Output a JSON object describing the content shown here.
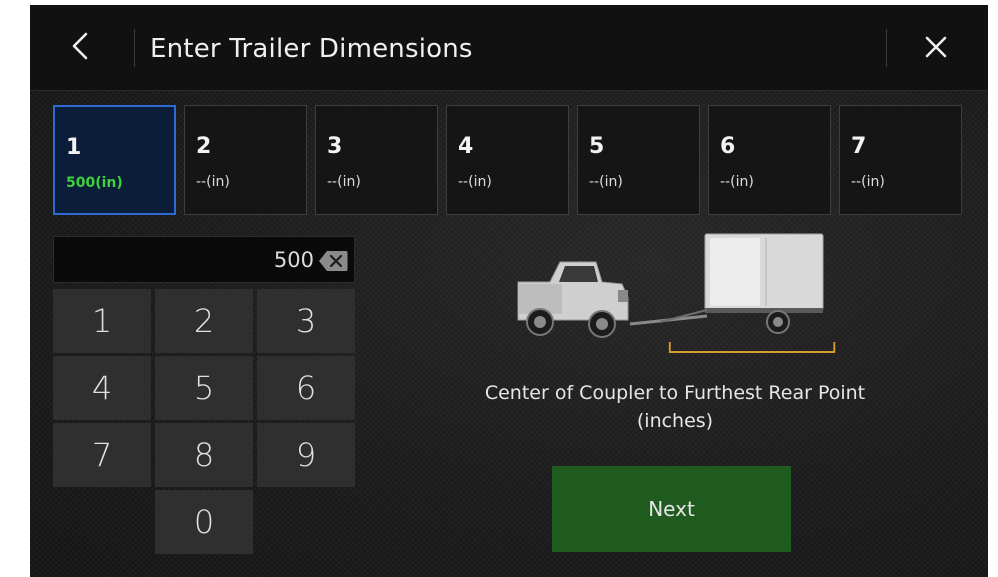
{
  "header": {
    "title": "Enter Trailer Dimensions",
    "back_icon": "chevron-left-icon",
    "close_icon": "close-icon"
  },
  "tabs": [
    {
      "number": "1",
      "value": "500(in)",
      "active": true
    },
    {
      "number": "2",
      "value": "--(in)",
      "active": false
    },
    {
      "number": "3",
      "value": "--(in)",
      "active": false
    },
    {
      "number": "4",
      "value": "--(in)",
      "active": false
    },
    {
      "number": "5",
      "value": "--(in)",
      "active": false
    },
    {
      "number": "6",
      "value": "--(in)",
      "active": false
    },
    {
      "number": "7",
      "value": "--(in)",
      "active": false
    }
  ],
  "entry": {
    "value": "500",
    "backspace_icon": "backspace-icon"
  },
  "keypad": {
    "keys": [
      "1",
      "2",
      "3",
      "4",
      "5",
      "6",
      "7",
      "8",
      "9",
      "0"
    ]
  },
  "illustration": {
    "icon": "truck-with-trailer-illustration"
  },
  "caption": {
    "line1": "Center of Coupler to Furthest Rear Point",
    "line2": "(inches)"
  },
  "next_button": {
    "label": "Next"
  },
  "colors": {
    "active_tab_bg": "#0c1d3a",
    "active_tab_border": "#2e6ad6",
    "active_value": "#3cd23c",
    "next_bg": "#1f5a1f",
    "dimension_line": "#d89a2a"
  }
}
